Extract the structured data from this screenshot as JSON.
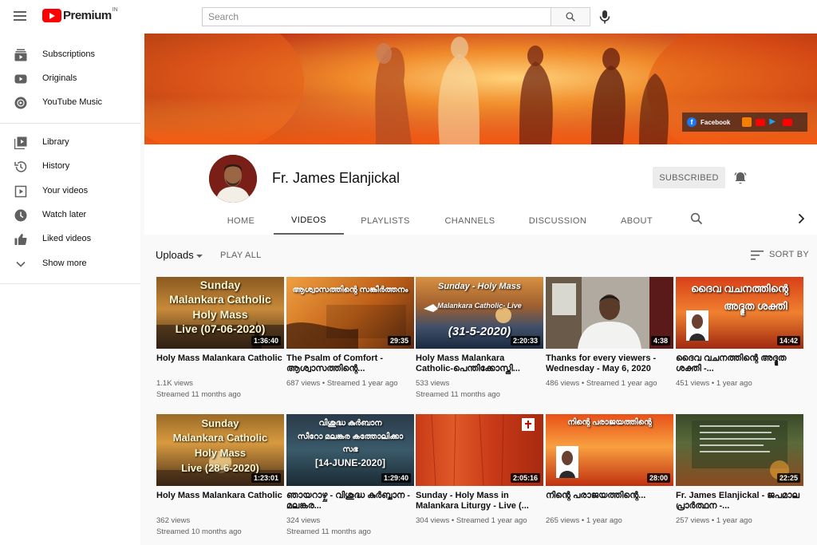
{
  "header": {
    "menu_icon": "hamburger-icon",
    "logo_text": "Premium",
    "logo_sup": "IN",
    "search_placeholder": "Search",
    "search_icon": "search-icon",
    "mic_icon": "mic-icon"
  },
  "sidebar": {
    "items": [
      {
        "label": "Subscriptions",
        "icon": "subscriptions-icon"
      },
      {
        "label": "Originals",
        "icon": "originals-icon"
      },
      {
        "label": "YouTube Music",
        "icon": "music-icon"
      },
      {
        "label": "Library",
        "icon": "library-icon"
      },
      {
        "label": "History",
        "icon": "history-icon"
      },
      {
        "label": "Your videos",
        "icon": "your-videos-icon"
      },
      {
        "label": "Watch later",
        "icon": "watch-later-icon"
      },
      {
        "label": "Liked videos",
        "icon": "thumbs-up-icon"
      },
      {
        "label": "Show more",
        "icon": "chevron-down-icon"
      }
    ]
  },
  "banner": {
    "facebook_label": "Facebook"
  },
  "channel": {
    "name": "Fr. James Elanjickal",
    "subscribe_label": "SUBSCRIBED",
    "tabs": [
      "HOME",
      "VIDEOS",
      "PLAYLISTS",
      "CHANNELS",
      "DISCUSSION",
      "ABOUT"
    ],
    "active_tab": "VIDEOS"
  },
  "toolbar": {
    "uploads_label": "Uploads",
    "play_all_label": "PLAY ALL",
    "sort_label": "SORT BY"
  },
  "videos": [
    {
      "title": "Holy Mass Malankara Catholic",
      "meta1": "1.1K views",
      "meta2": "Streamed 11 months ago",
      "duration": "1:36:40",
      "thumb_lines": [
        "Sunday",
        "Malankara Catholic",
        "Holy Mass",
        "Live (07-06-2020)"
      ]
    },
    {
      "title": "The Psalm of Comfort - ആശ്വാസത്തിന്റെ...",
      "meta1": "687 views • Streamed 1 year ago",
      "meta2": "",
      "duration": "29:35",
      "thumb_lines": [
        "ആശ്വാസത്തിന്റെ സങ്കീർത്തനം"
      ]
    },
    {
      "title": "Holy Mass Malankara Catholic-പെന്തിക്കോസ്തി...",
      "meta1": "533 views",
      "meta2": "Streamed 11 months ago",
      "duration": "2:20:33",
      "thumb_lines": [
        "Sunday - Holy Mass",
        "Malankara Catholic- Live",
        "(31-5-2020)"
      ]
    },
    {
      "title": "Thanks for every viewers - Wednesday - May 6, 2020",
      "meta1": "486 views • Streamed 1 year ago",
      "meta2": "",
      "duration": "4:38",
      "thumb_lines": []
    },
    {
      "title": "ദൈവ വചനത്തിന്റെ അദ്ഭുത ശക്തി -...",
      "meta1": "451 views • 1 year ago",
      "meta2": "",
      "duration": "14:42",
      "thumb_lines": [
        "ദൈവ വചനത്തിന്റെ",
        "അദ്ഭുത ശക്തി"
      ]
    },
    {
      "title": "Holy Mass Malankara Catholic",
      "meta1": "362 views",
      "meta2": "Streamed 10 months ago",
      "duration": "1:23:01",
      "thumb_lines": [
        "Sunday",
        "Malankara Catholic",
        "Holy Mass",
        "Live (28-6-2020)"
      ]
    },
    {
      "title": "ഞായറാഴ്ച - വിശുദ്ധ കുർബ്ബാന - മലങ്കര...",
      "meta1": "324 views",
      "meta2": "Streamed 11 months ago",
      "duration": "1:29:40",
      "thumb_lines": [
        "വിശുദ്ധ കുർബാന",
        "സീറോ മലങ്കര കത്തോലിക്കാ",
        "സഭ",
        "[14-JUNE-2020]"
      ]
    },
    {
      "title": "Sunday - Holy Mass in Malankara Liturgy - Live (...",
      "meta1": "304 views • Streamed 1 year ago",
      "meta2": "",
      "duration": "2:05:16",
      "thumb_lines": []
    },
    {
      "title": "നിന്റെ പരാജയത്തിന്റെ...",
      "meta1": "265 views • 1 year ago",
      "meta2": "",
      "duration": "28:00",
      "thumb_lines": [
        "നിന്റെ പരാജയത്തിന്റെ"
      ]
    },
    {
      "title": "Fr. James Elanjickal - ജപമാല പ്രാർത്ഥന -...",
      "meta1": "257 views • 1 year ago",
      "meta2": "",
      "duration": "22:25",
      "thumb_lines": []
    }
  ]
}
